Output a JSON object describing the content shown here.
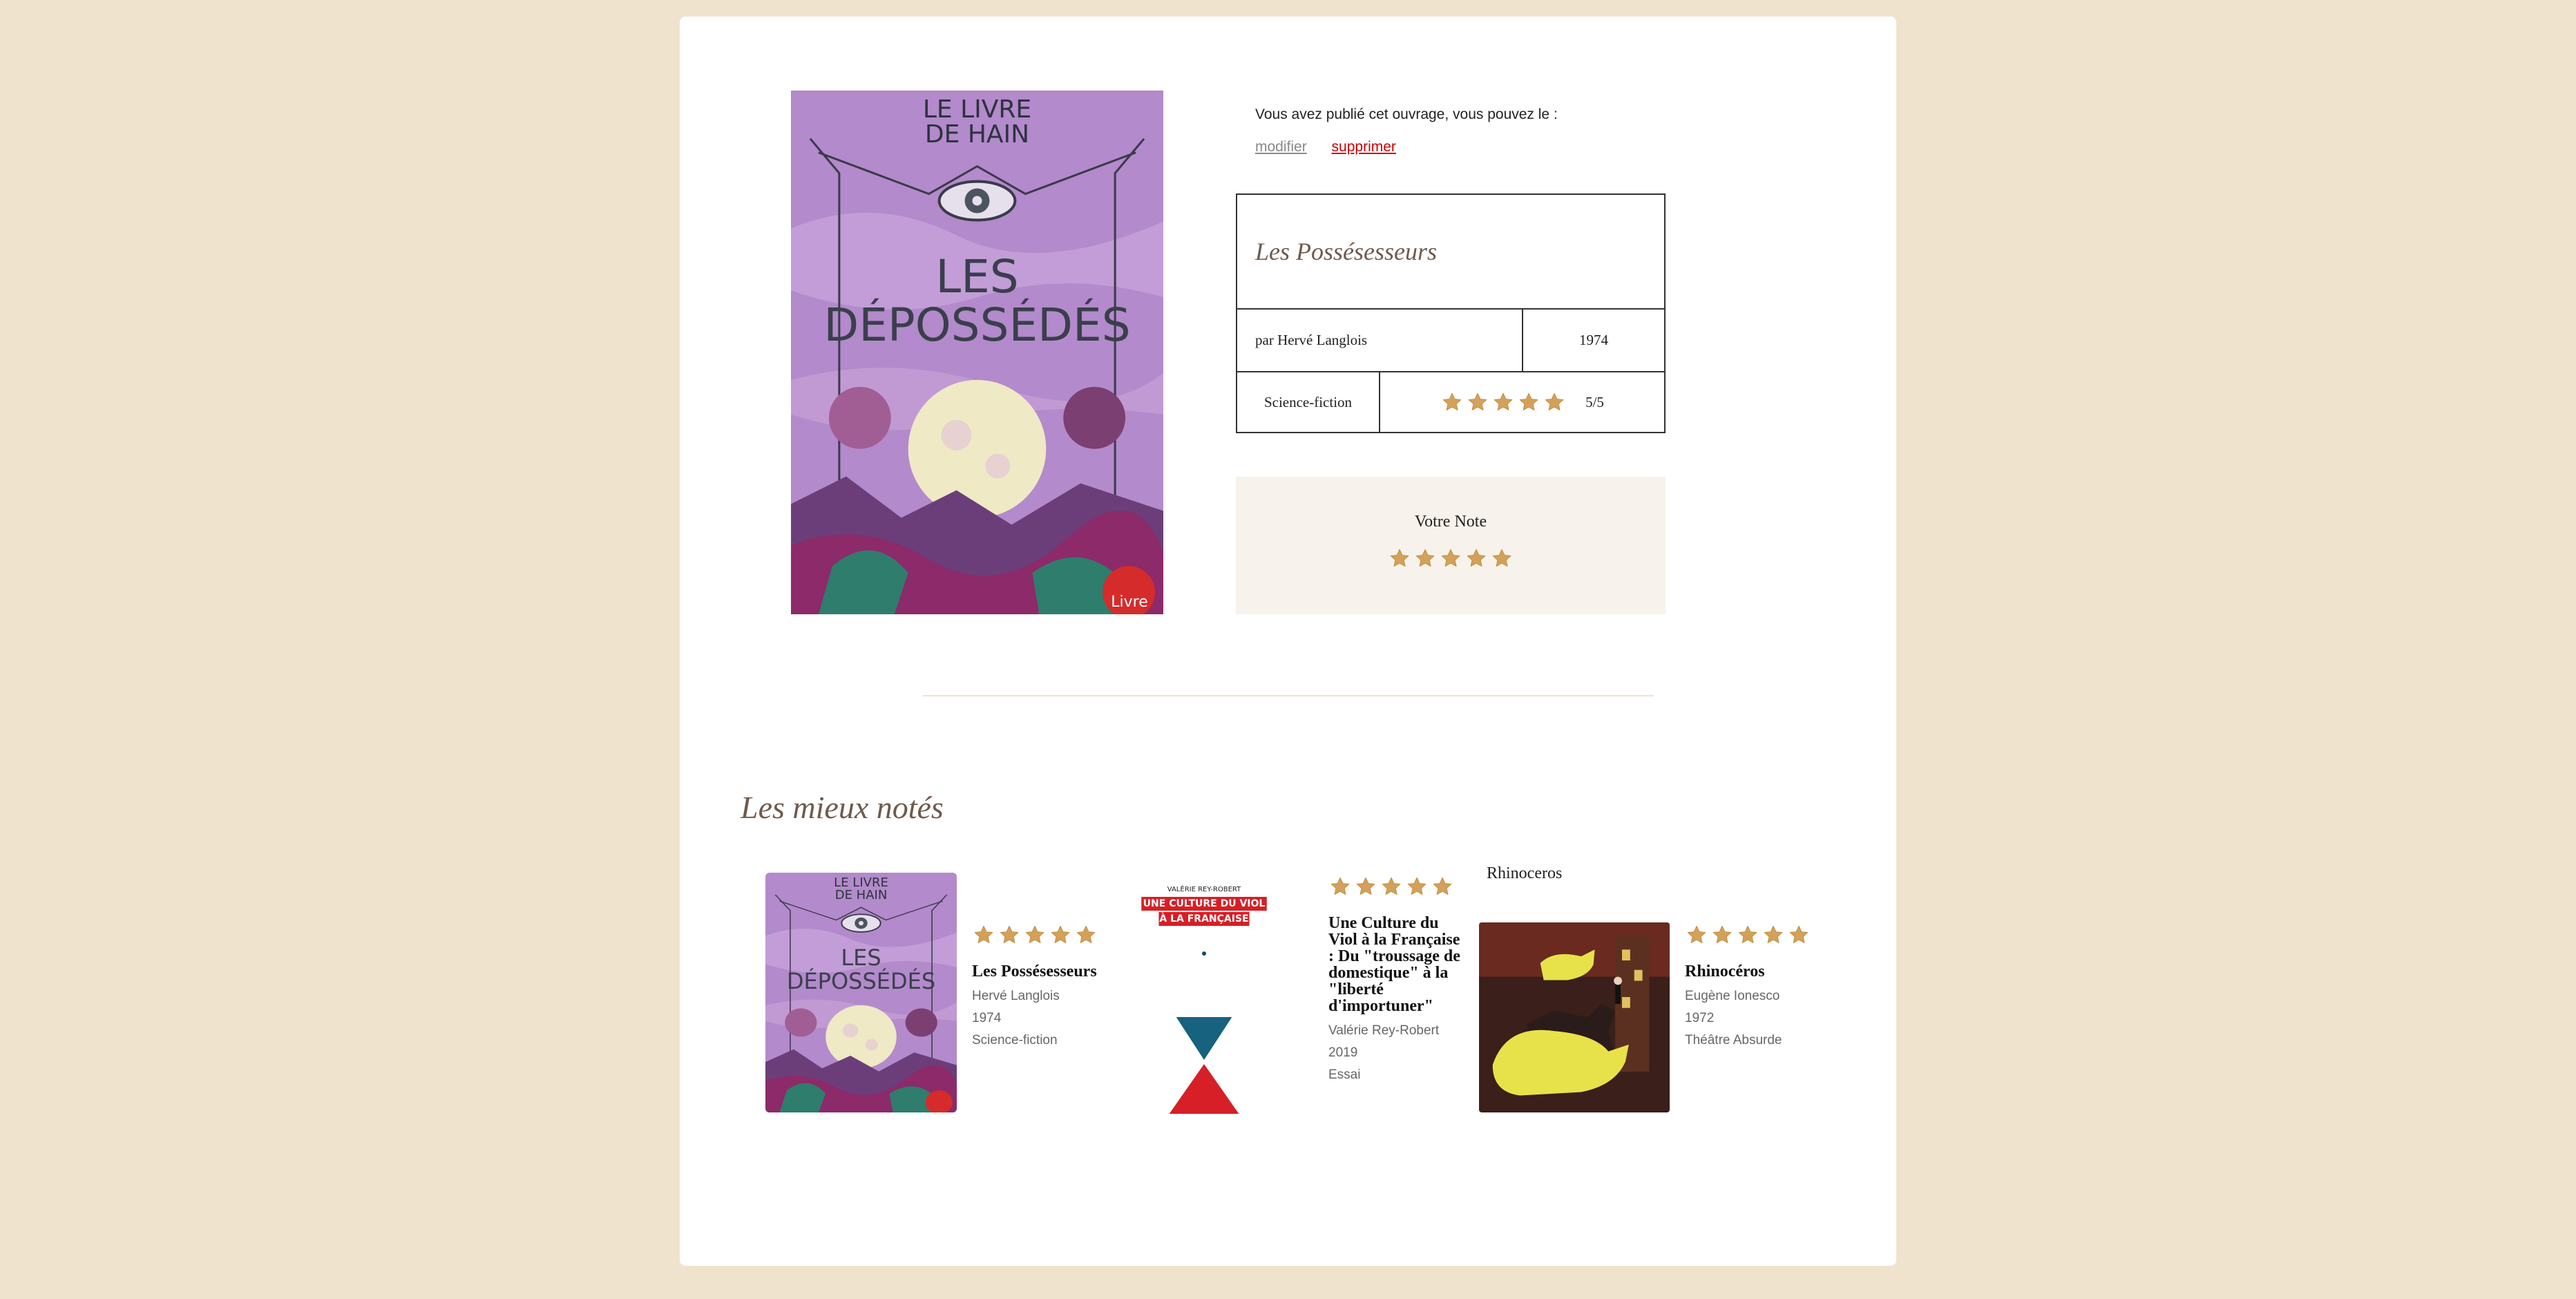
{
  "owner": {
    "text": "Vous avez publié cet ouvrage, vous pouvez le :",
    "edit_label": "modifier",
    "delete_label": "supprimer"
  },
  "book": {
    "title": "Les Possésesseurs",
    "author": "par Hervé Langlois",
    "year": "1974",
    "genre": "Science-fiction",
    "rating": 5,
    "rating_text": "5/5",
    "cover_icon": "book-cover-les-depossedes",
    "cover_lines": [
      "LE LIVRE",
      "DE HAIN",
      "LES",
      "DÉPOSSÉDÉS",
      "Livre"
    ]
  },
  "vote": {
    "label": "Votre Note",
    "stars": 5
  },
  "top_rated": {
    "heading": "Les mieux notés",
    "items": [
      {
        "title": "Les Possésesseurs",
        "author": "Hervé Langlois",
        "year": "1974",
        "genre": "Science-fiction",
        "rating": 5,
        "cover_icon": "book-cover-les-depossedes"
      },
      {
        "title": "Une Culture du Viol à la Française : Du \"troussage de domestique\" à la \"liberté d'importuner\"",
        "author": "Valérie Rey-Robert",
        "year": "2019",
        "genre": "Essai",
        "rating": 5,
        "cover_icon": "book-cover-culture-du-viol",
        "cover_lines": [
          "VALÉRIE REY-ROBERT",
          "UNE CULTURE DU VIOL",
          "À LA FRANÇAISE"
        ]
      },
      {
        "title": "Rhinocéros",
        "author": "Eugène Ionesco",
        "year": "1972",
        "genre": "Théâtre Absurde",
        "rating": 5,
        "cover_icon": "book-cover-rhinoceros",
        "cover_alt": "Rhinoceros"
      }
    ]
  },
  "colors": {
    "background": "#f0e3cd",
    "star": "#d4a15a",
    "delete_link": "#cc0000",
    "heading": "#6e5a4c"
  }
}
